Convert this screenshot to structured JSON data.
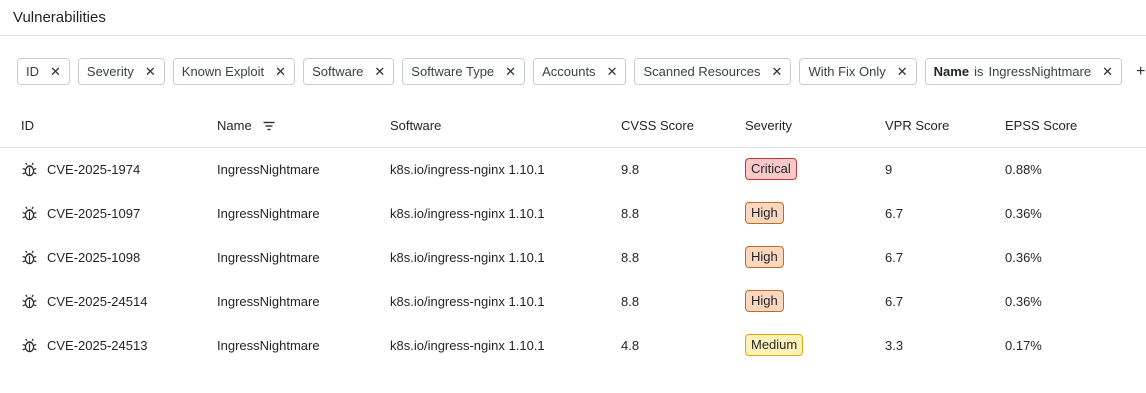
{
  "page": {
    "title": "Vulnerabilities"
  },
  "filters": {
    "chips": [
      {
        "label": "ID"
      },
      {
        "label": "Severity"
      },
      {
        "label": "Known Exploit"
      },
      {
        "label": "Software"
      },
      {
        "label": "Software Type"
      },
      {
        "label": "Accounts"
      },
      {
        "label": "Scanned Resources"
      },
      {
        "label": "With Fix Only"
      }
    ],
    "name_filter": {
      "key": "Name",
      "operator": "is",
      "value": "IngressNightmare"
    },
    "add_icon": "plus-icon",
    "remove_icon": "close-icon"
  },
  "table": {
    "headers": {
      "id": "ID",
      "name": "Name",
      "software": "Software",
      "cvss": "CVSS Score",
      "severity": "Severity",
      "vpr": "VPR Score",
      "epss": "EPSS Score"
    },
    "rows": [
      {
        "id": "CVE-2025-1974",
        "name": "IngressNightmare",
        "software": "k8s.io/ingress-nginx 1.10.1",
        "cvss": "9.8",
        "severity": "Critical",
        "vpr": "9",
        "epss": "0.88%"
      },
      {
        "id": "CVE-2025-1097",
        "name": "IngressNightmare",
        "software": "k8s.io/ingress-nginx 1.10.1",
        "cvss": "8.8",
        "severity": "High",
        "vpr": "6.7",
        "epss": "0.36%"
      },
      {
        "id": "CVE-2025-1098",
        "name": "IngressNightmare",
        "software": "k8s.io/ingress-nginx 1.10.1",
        "cvss": "8.8",
        "severity": "High",
        "vpr": "6.7",
        "epss": "0.36%"
      },
      {
        "id": "CVE-2025-24514",
        "name": "IngressNightmare",
        "software": "k8s.io/ingress-nginx 1.10.1",
        "cvss": "8.8",
        "severity": "High",
        "vpr": "6.7",
        "epss": "0.36%"
      },
      {
        "id": "CVE-2025-24513",
        "name": "IngressNightmare",
        "software": "k8s.io/ingress-nginx 1.10.1",
        "cvss": "4.8",
        "severity": "Medium",
        "vpr": "3.3",
        "epss": "0.17%"
      }
    ],
    "severity_colors": {
      "Critical": {
        "bg": "#f9c8c8",
        "border": "#c8383b"
      },
      "High": {
        "bg": "#fbd7bf",
        "border": "#c66a1f"
      },
      "Medium": {
        "bg": "#fdf1b7",
        "border": "#d7a712"
      }
    },
    "row_icon": "bug-icon",
    "sort_icon": "filter-lines-icon"
  }
}
